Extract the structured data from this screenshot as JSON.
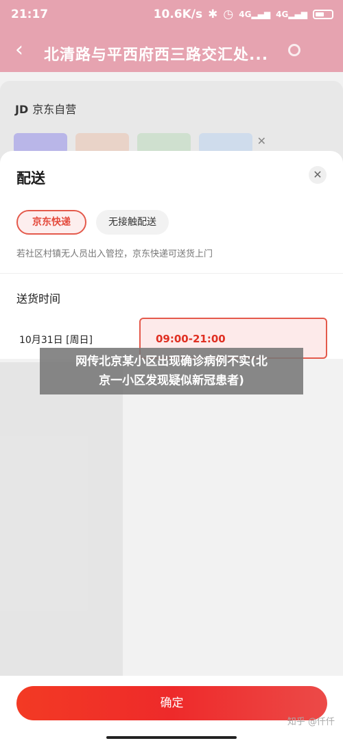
{
  "status_bar": {
    "time": "21:17",
    "network_speed": "10.6K/s",
    "icons": [
      "bluetooth-icon",
      "alarm-icon",
      "hd-icon",
      "signal-4g-icon",
      "signal-4g-icon",
      "battery-icon"
    ]
  },
  "header": {
    "address": "北清路与平西府西三路交汇处..."
  },
  "store": {
    "logo": "JD",
    "name": "京东自营"
  },
  "sheet": {
    "title": "配送",
    "close_icon": "close-icon",
    "delivery_options": [
      {
        "label": "京东快递",
        "selected": true
      },
      {
        "label": "无接触配送",
        "selected": false
      }
    ],
    "notice": "若社区村镇无人员出入管控，京东快递可送货上门",
    "delivery_time_title": "送货时间",
    "date": "10月31日 [周日]",
    "time_slot": "09:00-21:00",
    "confirm_label": "确定"
  },
  "banner": {
    "line1": "网传北京某小区出现确诊病例不实(北",
    "line2": "京一小区发现疑似新冠患者)"
  },
  "watermark": "知乎 @仟仟",
  "colors": {
    "accent": "#e4493b",
    "header_pink": "#e6a3b0",
    "selected_bg": "#fdeaea"
  }
}
